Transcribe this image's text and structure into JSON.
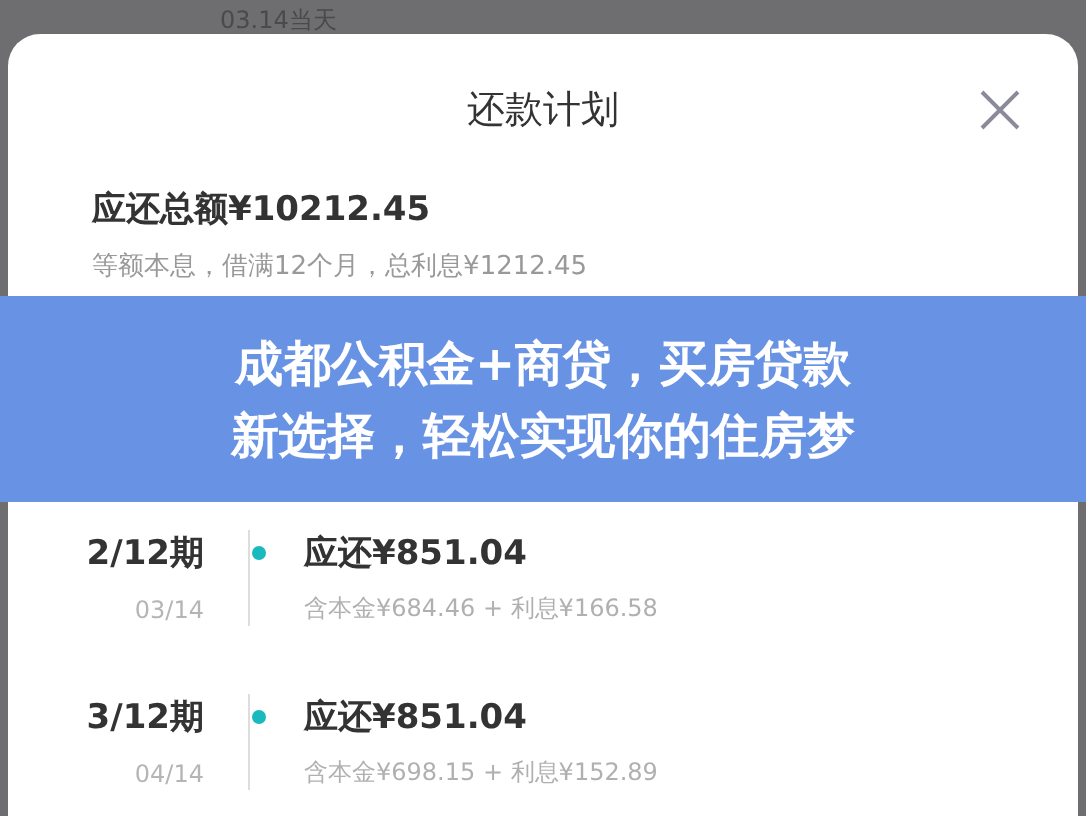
{
  "background_text": "03.14当天",
  "sheet": {
    "title": "还款计划",
    "total": "应还总额¥10212.45",
    "summary": "等额本息，借满12个月，总利息¥1212.45"
  },
  "banner": {
    "lines": [
      "成都公积金+商贷，买房贷款",
      "新选择，轻松实现你的住房梦"
    ]
  },
  "installments": [
    {
      "period": "2/12期",
      "date": "03/14",
      "amount": "应还¥851.04",
      "detail": "含本金¥684.46 + 利息¥166.58"
    },
    {
      "period": "3/12期",
      "date": "04/14",
      "amount": "应还¥851.04",
      "detail": "含本金¥698.15 + 利息¥152.89"
    }
  ]
}
